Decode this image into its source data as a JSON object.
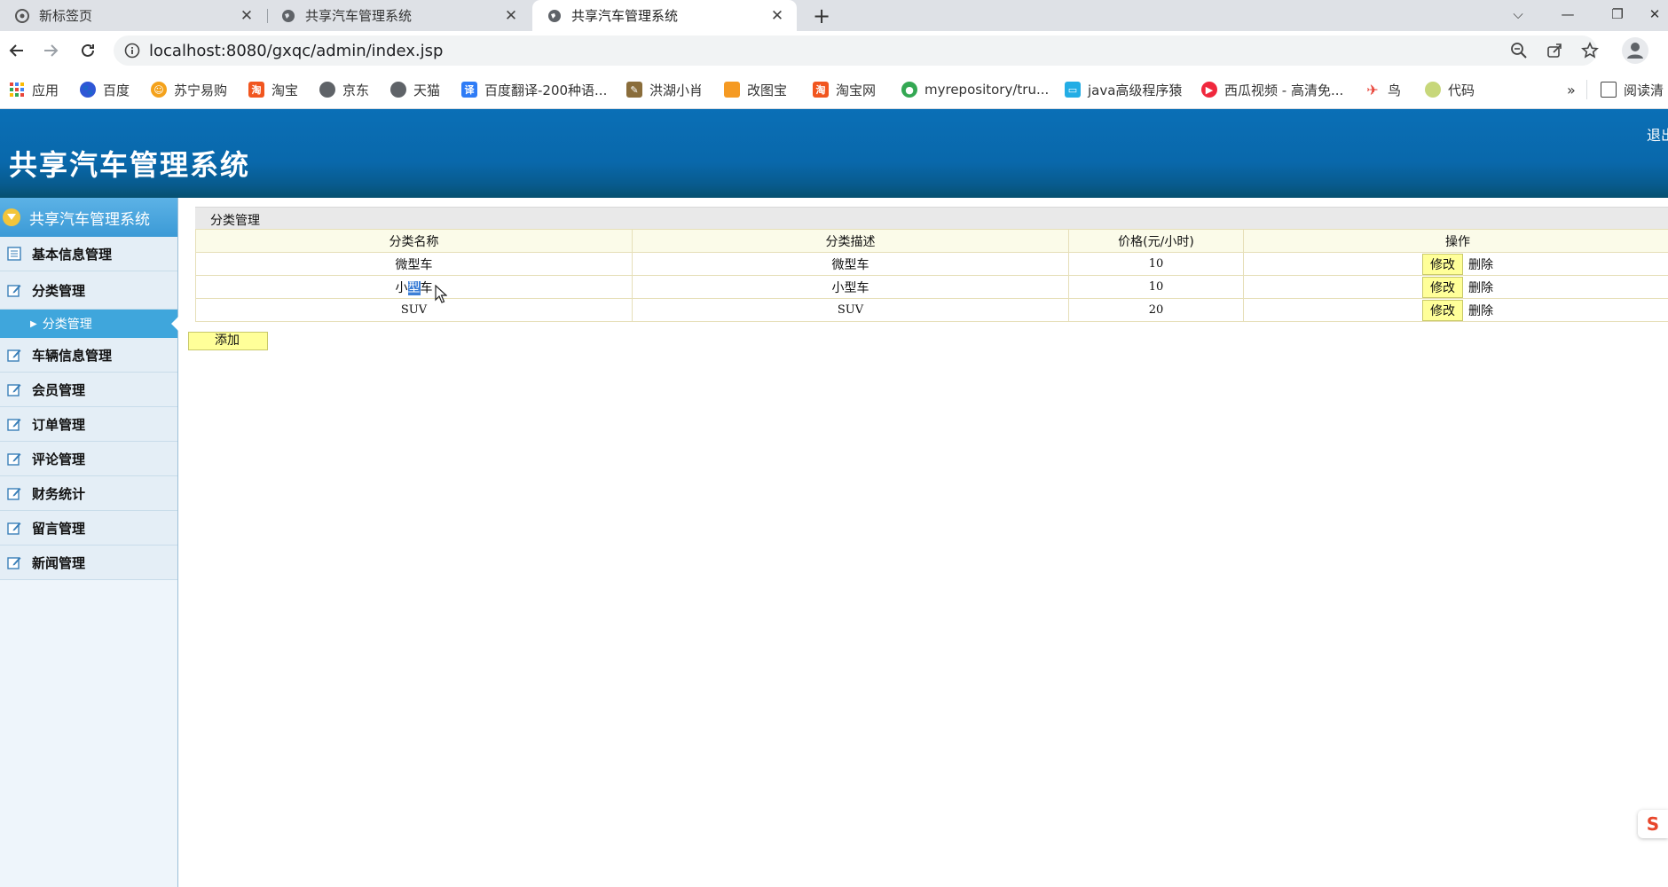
{
  "browser": {
    "tabs": [
      {
        "title": "新标签页",
        "active": false
      },
      {
        "title": "共享汽车管理系统",
        "active": false
      },
      {
        "title": "共享汽车管理系统",
        "active": true
      }
    ],
    "url": "localhost:8080/gxqc/admin/index.jsp",
    "bookmarks": [
      {
        "label": "应用",
        "icon": "apps-grid-icon",
        "color": "#e8463b"
      },
      {
        "label": "百度",
        "icon": "baidu-paw-icon",
        "color": "#2e56d6"
      },
      {
        "label": "苏宁易购",
        "icon": "lion-icon",
        "color": "#f4a21c"
      },
      {
        "label": "淘宝",
        "icon": "taobao-icon",
        "color": "#f1561f"
      },
      {
        "label": "京东",
        "icon": "globe-icon",
        "color": "#5f6368"
      },
      {
        "label": "天猫",
        "icon": "globe-icon",
        "color": "#5f6368"
      },
      {
        "label": "百度翻译-200种语...",
        "icon": "translate-icon",
        "color": "#2f7cf6"
      },
      {
        "label": "洪湖小肖",
        "icon": "feather-icon",
        "color": "#8a6d3b"
      },
      {
        "label": "改图宝",
        "icon": "orange-square-icon",
        "color": "#f59a23"
      },
      {
        "label": "淘宝网",
        "icon": "taobao-icon",
        "color": "#f1561f"
      },
      {
        "label": "myrepository/tru...",
        "icon": "chrome-icon",
        "color": "#34a853"
      },
      {
        "label": "java高级程序猿",
        "icon": "bilibili-icon",
        "color": "#23ade5"
      },
      {
        "label": "西瓜视频 - 高清免...",
        "icon": "play-icon",
        "color": "#f0283d"
      },
      {
        "label": "鸟",
        "icon": "bird-icon",
        "color": "#e8463b"
      },
      {
        "label": "代码",
        "icon": "leaf-icon",
        "color": "#c7d77a"
      }
    ],
    "reading_list": "阅读清"
  },
  "header": {
    "title": "共享汽车管理系统",
    "logout": "退出"
  },
  "sidebar": {
    "head": "共享汽车管理系统",
    "items": [
      {
        "label": "基本信息管理",
        "icon": "list-icon"
      },
      {
        "label": "分类管理",
        "icon": "edit-icon"
      },
      {
        "label": "车辆信息管理",
        "icon": "edit-icon"
      },
      {
        "label": "会员管理",
        "icon": "edit-icon"
      },
      {
        "label": "订单管理",
        "icon": "edit-icon"
      },
      {
        "label": "评论管理",
        "icon": "edit-icon"
      },
      {
        "label": "财务统计",
        "icon": "edit-icon"
      },
      {
        "label": "留言管理",
        "icon": "edit-icon"
      },
      {
        "label": "新闻管理",
        "icon": "edit-icon"
      }
    ],
    "sub_item": "分类管理"
  },
  "main": {
    "panel_title": "分类管理",
    "columns": [
      "分类名称",
      "分类描述",
      "价格(元/小时)",
      "操作"
    ],
    "rows": [
      {
        "name": "微型车",
        "desc": "微型车",
        "price": "10"
      },
      {
        "name_pre": "小",
        "name_sel": "型",
        "name_post": "车",
        "desc": "小型车",
        "price": "10"
      },
      {
        "name": "SUV",
        "desc": "SUV",
        "price": "20"
      }
    ],
    "edit_label": "修改",
    "delete_label": "删除",
    "add_label": "添加"
  },
  "floating_badge": "S"
}
